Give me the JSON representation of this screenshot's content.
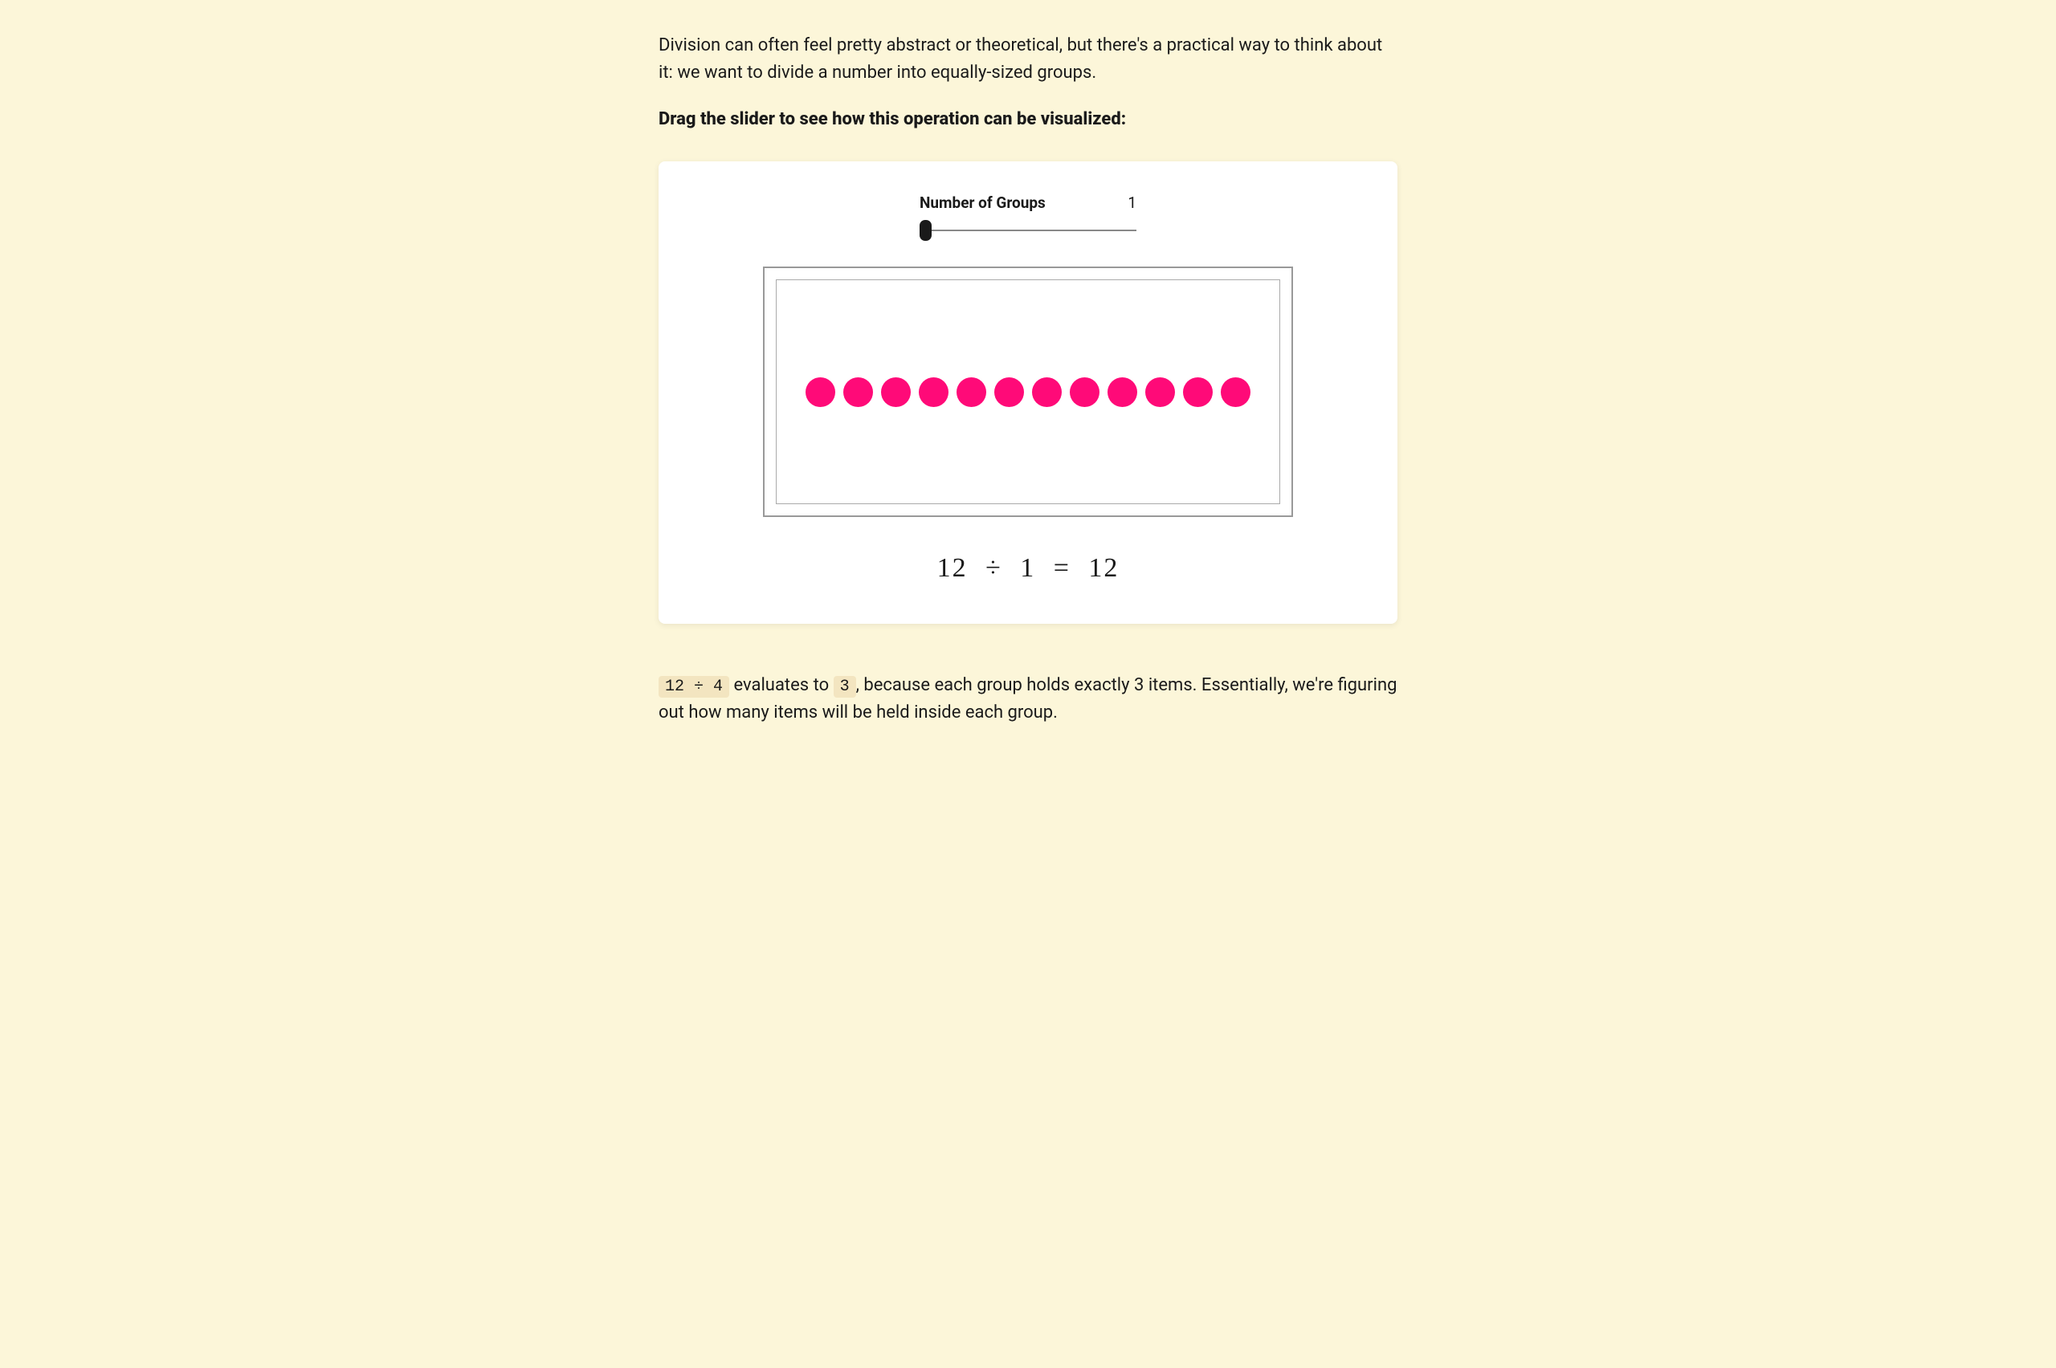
{
  "intro": "Division can often feel pretty abstract or theoretical, but there's a practical way to think about it: we want to divide a number into equally-sized groups.",
  "instruction": "Drag the slider to see how this operation can be visualized:",
  "slider": {
    "label": "Number of Groups",
    "value": "1"
  },
  "visualization": {
    "dot_count": 12
  },
  "equation": {
    "dividend": "12",
    "divide_sign": "÷",
    "divisor": "1",
    "equals_sign": "=",
    "quotient": "12"
  },
  "explanation": {
    "code1": "12 ÷ 4",
    "text1": " evaluates to ",
    "code2": "3",
    "text2": ", because each group holds exactly 3 items. Essentially, we're figuring out how many items will be held inside each group."
  }
}
